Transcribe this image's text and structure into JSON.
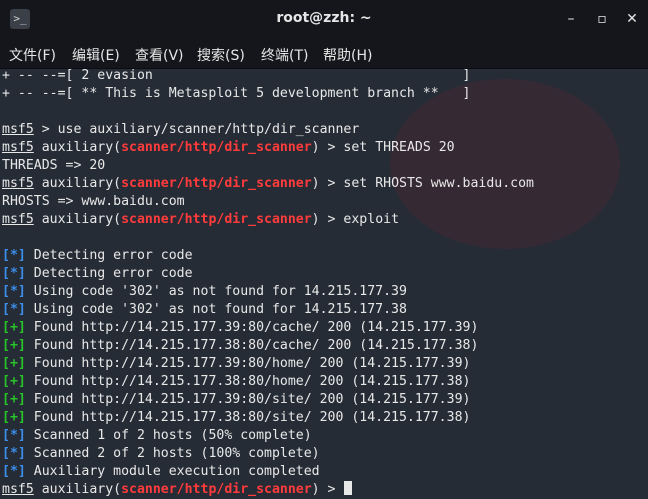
{
  "window": {
    "title": "root@zzh: ~",
    "app_icon": "terminal-icon",
    "controls": [
      "minimize-icon",
      "maximize-icon",
      "close-icon"
    ],
    "control_glyphs": {
      "minimize": "–",
      "maximize": "▫",
      "close": "✕"
    }
  },
  "menu": {
    "file": "文件(F)",
    "edit": "编辑(E)",
    "view": "查看(V)",
    "search": "搜索(S)",
    "terminal": "终端(T)",
    "help": "帮助(H)"
  },
  "colors": {
    "terminal_bg": "#262c36",
    "titlebar_bg": "#14161b",
    "module_red": "#ff3b3b",
    "status_blue": "#3b8eea",
    "found_green": "#29c229"
  },
  "terminal": {
    "prompt": "msf5",
    "module": "scanner/http/dir_scanner",
    "lines": {
      "l1": "+ -- --=[ 2 evasion                                       ]",
      "l2": "+ -- --=[ ** This is Metasploit 5 development branch **   ]",
      "l4": " > use auxiliary/scanner/http/dir_scanner",
      "aux_open": " auxiliary(",
      "l5_cmd": ") > set THREADS 20",
      "l6": "THREADS => 20",
      "l7_cmd": ") > set RHOSTS www.baidu.com",
      "l8": "RHOSTS => www.baidu.com",
      "l9_cmd": ") > exploit",
      "tag_info": "[*]",
      "tag_plus": "[+]",
      "o1": " Detecting error code",
      "o2": " Detecting error code",
      "o3": " Using code '302' as not found for 14.215.177.39",
      "o4": " Using code '302' as not found for 14.215.177.38",
      "o5": " Found http://14.215.177.39:80/cache/ 200 (14.215.177.39)",
      "o6": " Found http://14.215.177.38:80/cache/ 200 (14.215.177.38)",
      "o7": " Found http://14.215.177.39:80/home/ 200 (14.215.177.39)",
      "o8": " Found http://14.215.177.38:80/home/ 200 (14.215.177.38)",
      "o9": " Found http://14.215.177.39:80/site/ 200 (14.215.177.39)",
      "o10": " Found http://14.215.177.38:80/site/ 200 (14.215.177.38)",
      "o11": " Scanned 1 of 2 hosts (50% complete)",
      "o12": " Scanned 2 of 2 hosts (100% complete)",
      "o13": " Auxiliary module execution completed",
      "last_cmd": ") > "
    }
  }
}
